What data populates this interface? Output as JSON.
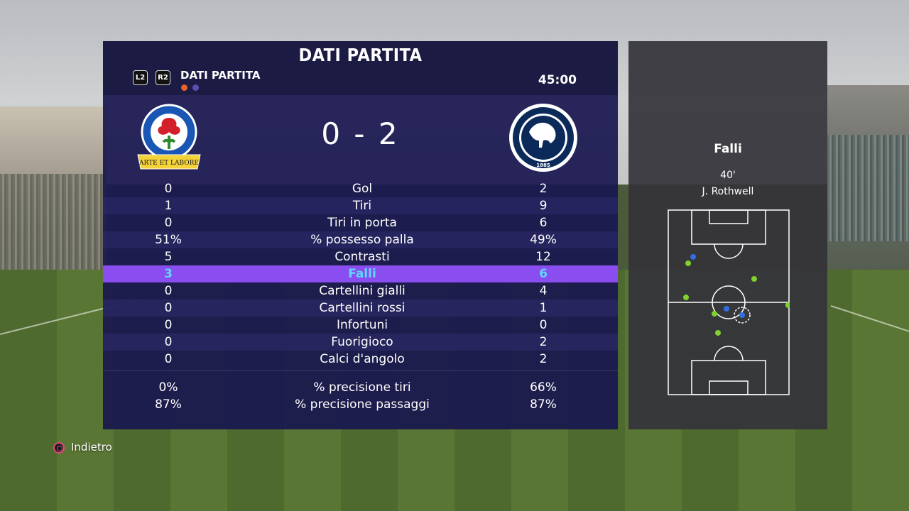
{
  "header": {
    "title": "DATI PARTITA",
    "subtitle": "DATI PARTITA",
    "left_button": "L2",
    "right_button": "R2",
    "time": "45:00",
    "page_dots": [
      "#e8612c",
      "#5a4fb0"
    ]
  },
  "match": {
    "home_crest_text": "BLACKBURN ROVERS F.C.",
    "home_crest_motto": "ARTE ET LABORE",
    "away_crest_text": "MILLWALL FOOTBALL CLUB",
    "away_crest_year": "1885",
    "score": "0 - 2"
  },
  "stats": [
    {
      "label": "Gol",
      "home": "0",
      "away": "2"
    },
    {
      "label": "Tiri",
      "home": "1",
      "away": "9"
    },
    {
      "label": "Tiri in porta",
      "home": "0",
      "away": "6"
    },
    {
      "label": "% possesso palla",
      "home": "51%",
      "away": "49%"
    },
    {
      "label": "Contrasti",
      "home": "5",
      "away": "12"
    },
    {
      "label": "Falli",
      "home": "3",
      "away": "6"
    },
    {
      "label": "Cartellini gialli",
      "home": "0",
      "away": "4"
    },
    {
      "label": "Cartellini rossi",
      "home": "0",
      "away": "1"
    },
    {
      "label": "Infortuni",
      "home": "0",
      "away": "0"
    },
    {
      "label": "Fuorigioco",
      "home": "0",
      "away": "2"
    },
    {
      "label": "Calci d'angolo",
      "home": "0",
      "away": "2"
    }
  ],
  "stats_extra": [
    {
      "label": "% precisione tiri",
      "home": "0%",
      "away": "66%"
    },
    {
      "label": "% precisione passaggi",
      "home": "87%",
      "away": "87%"
    }
  ],
  "side": {
    "title": "Falli",
    "minute": "40'",
    "player": "J. Rothwell"
  },
  "footer": {
    "back_label": "Indietro"
  },
  "colors": {
    "highlight_row": "#8a4ef0",
    "highlight_text": "#5ed8ff",
    "home_dot": "#7fd12f",
    "away_dot": "#2f6fe0"
  }
}
